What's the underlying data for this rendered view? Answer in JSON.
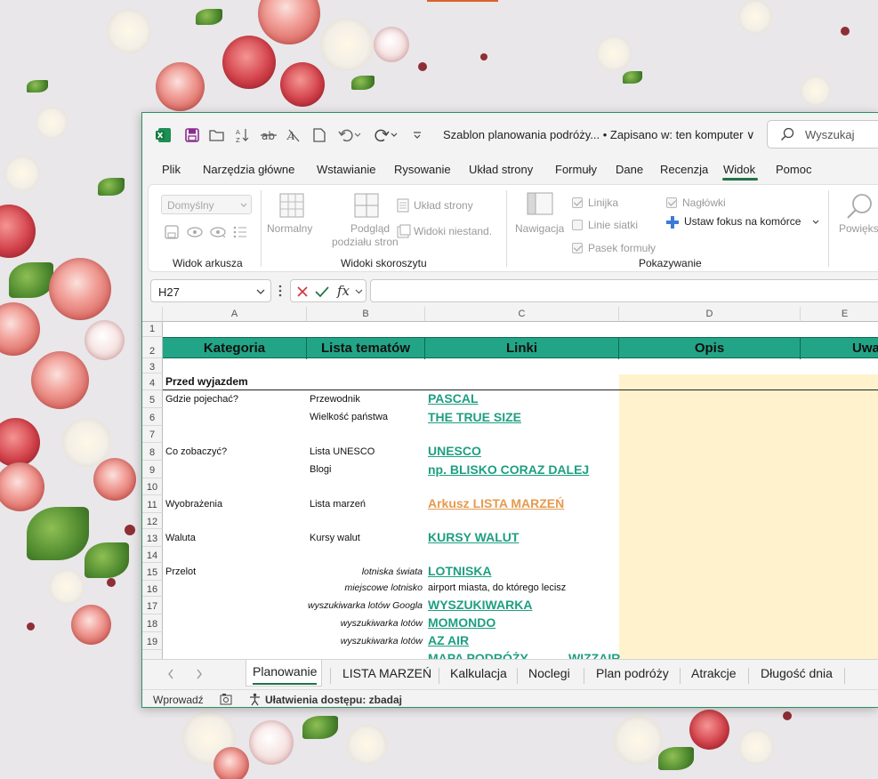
{
  "window": {
    "doc_title": "Szablon planowania podróży...  •  Zapisano w: ten komputer ∨",
    "search_placeholder": "Wyszukaj"
  },
  "menu": [
    "Plik",
    "Narzędzia główne",
    "Wstawianie",
    "Rysowanie",
    "Układ strony",
    "Formuły",
    "Dane",
    "Recenzja",
    "Widok",
    "Pomoc"
  ],
  "active_menu": "Widok",
  "ribbon": {
    "sheet_view_combo": "Domyślny",
    "group_sheet_view": "Widok arkusza",
    "normal": "Normalny",
    "page_break_line1": "Podgląd",
    "page_break_line2": "podziału stron",
    "page_layout": "Układ strony",
    "custom_views": "Widoki niestand.",
    "group_workbook_views": "Widoki skoroszytu",
    "navigation": "Nawigacja",
    "ruler": "Linijka",
    "gridlines": "Linie siatki",
    "formula_bar": "Pasek formuły",
    "headings": "Nagłówki",
    "focus_cell": "Ustaw fokus na komórce",
    "group_show": "Pokazywanie",
    "zoom": "Powiększ"
  },
  "formula": {
    "namebox": "H27",
    "fx": "fx",
    "value": ""
  },
  "grid": {
    "columns": [
      "A",
      "B",
      "C",
      "D",
      "E"
    ],
    "rows": [
      "1",
      "2",
      "3",
      "4",
      "5",
      "6",
      "7",
      "8",
      "9",
      "10",
      "11",
      "12",
      "13",
      "14",
      "15",
      "16",
      "17",
      "18",
      "19"
    ],
    "headers": [
      "Kategoria",
      "Lista tematów",
      "Linki",
      "Opis",
      "Uwa"
    ],
    "section": "Przed wyjazdem",
    "a5": "Gdzie pojechać?",
    "b5": "Przewodnik",
    "c5": "PASCAL",
    "b6": "Wielkość państwa",
    "c6": "THE TRUE SIZE",
    "a8": "Co zobaczyć?",
    "b8": "Lista UNESCO",
    "c8": "UNESCO",
    "b9": "Blogi",
    "c9": "np. BLISKO CORAZ DALEJ",
    "a11": "Wyobrażenia",
    "b11": "Lista marzeń",
    "c11": "Arkusz LISTA MARZEŃ",
    "a13": "Waluta",
    "b13": "Kursy walut",
    "c13": "KURSY WALUT",
    "a15": "Przelot",
    "b15": "lotniska świata",
    "c15": "LOTNISKA",
    "b16": "miejscowe lotnisko",
    "c16": "airport miasta, do którego lecisz",
    "b17": "wyszukiwarka lotów Googla",
    "c17": "WYSZUKIWARKA",
    "b18": "wyszukiwarka lotów",
    "c18": "MOMONDO",
    "b19": "wyszukiwarka lotów",
    "c19": "AZ AIR",
    "c20": "MAPA PODRÓŻY",
    "c20b": "WIZZAIR"
  },
  "tabs": [
    "Planowanie",
    "LISTA MARZEŃ",
    "Kalkulacja",
    "Noclegi",
    "Plan podróży",
    "Atrakcje",
    "Długość dnia"
  ],
  "active_tab": "Planowanie",
  "status": {
    "mode": "Wprowadź",
    "accessibility": "Ułatwienia dostępu: zbadaj"
  },
  "colors": {
    "excel_green": "#217346",
    "header_teal": "#22a586",
    "link_teal": "#1e9f82",
    "link_orange": "#e69a4e",
    "opis_fill": "#fff2cc"
  }
}
